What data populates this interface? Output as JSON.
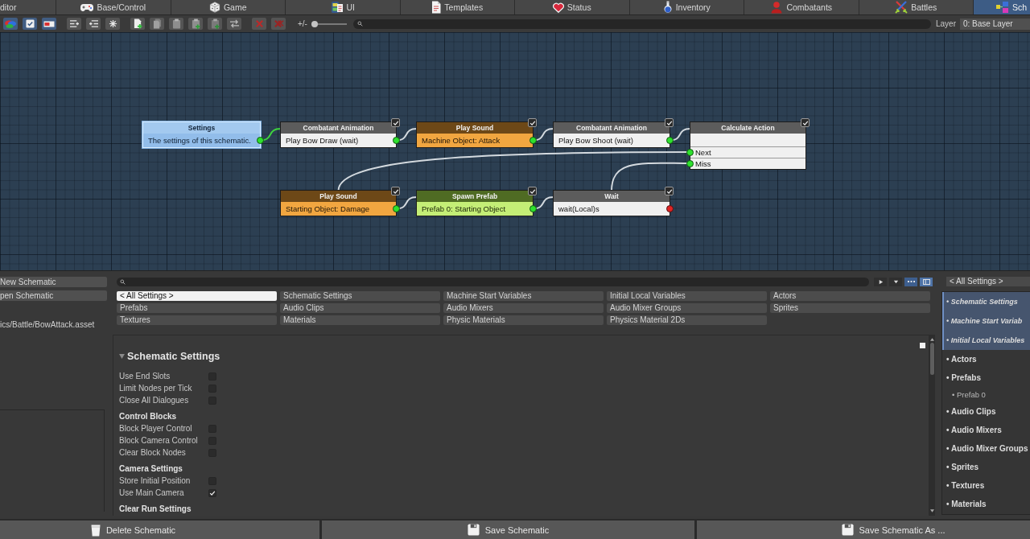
{
  "tabs": [
    {
      "label": "ditor",
      "selected": false
    },
    {
      "label": "Base/Control",
      "selected": false
    },
    {
      "label": "Game",
      "selected": false
    },
    {
      "label": "UI",
      "selected": false
    },
    {
      "label": "Templates",
      "selected": false
    },
    {
      "label": "Status",
      "selected": false
    },
    {
      "label": "Inventory",
      "selected": false
    },
    {
      "label": "Combatants",
      "selected": false
    },
    {
      "label": "Battles",
      "selected": false
    },
    {
      "label": "Sch",
      "selected": true
    }
  ],
  "toolbar": {
    "toggles": [
      {
        "on": true
      },
      {
        "on": true
      },
      {
        "on": true
      }
    ],
    "zoom_label": "+/-",
    "zoom_slider": {
      "level": 0.1
    },
    "layer_label": "Layer",
    "layer": "0: Base Layer"
  },
  "canvas": {
    "nodes": [
      {
        "title": "Settings",
        "kind": "settings",
        "selected": true,
        "rows": [
          {
            "label": "The settings of this schematic.",
            "connected": true
          }
        ]
      },
      {
        "title": "Combatant Animation",
        "kind": "step",
        "selected": false,
        "checked": true,
        "rows": [
          {
            "label": "Play Bow Draw (wait)",
            "connected": true
          }
        ]
      },
      {
        "title": "Play Sound",
        "kind": "audio",
        "selected": false,
        "checked": true,
        "rows": [
          {
            "label": "Machine Object: Attack",
            "connected": true
          }
        ]
      },
      {
        "title": "Combatant Animation",
        "kind": "step",
        "selected": false,
        "checked": true,
        "rows": [
          {
            "label": "Play Bow Shoot (wait)",
            "connected": true
          }
        ]
      },
      {
        "title": "Calculate Action",
        "kind": "check",
        "selected": false,
        "checked": true,
        "rows": [
          {
            "label": "Next",
            "connected": true
          },
          {
            "label": "Miss",
            "connected": true
          }
        ]
      },
      {
        "title": "Play Sound",
        "kind": "audio",
        "selected": false,
        "checked": true,
        "rows": [
          {
            "label": "Starting Object: Damage",
            "connected": true
          }
        ]
      },
      {
        "title": "Spawn Prefab",
        "kind": "spawn",
        "selected": false,
        "checked": true,
        "rows": [
          {
            "label": "Prefab 0: Starting Object",
            "connected": true
          }
        ]
      },
      {
        "title": "Wait",
        "kind": "step",
        "selected": false,
        "checked": true,
        "rows": [
          {
            "label": "wait(Local)s",
            "connected": false
          }
        ]
      }
    ]
  },
  "sidebar": {
    "buttons": [
      "New Schematic",
      "pen Schematic"
    ],
    "path": "ics/Battle/BowAttack.asset"
  },
  "settings_filter": [
    {
      "label": "< All Settings >",
      "selected": true
    },
    {
      "label": "Schematic Settings",
      "selected": false
    },
    {
      "label": "Machine Start Variables",
      "selected": false
    },
    {
      "label": "Initial Local Variables",
      "selected": false
    },
    {
      "label": "Actors",
      "selected": false
    },
    {
      "label": "Prefabs",
      "selected": false
    },
    {
      "label": "Audio Clips",
      "selected": false
    },
    {
      "label": "Audio Mixers",
      "selected": false
    },
    {
      "label": "Audio Mixer Groups",
      "selected": false
    },
    {
      "label": "Sprites",
      "selected": false
    },
    {
      "label": "Textures",
      "selected": false
    },
    {
      "label": "Materials",
      "selected": false
    },
    {
      "label": "Physic Materials",
      "selected": false
    },
    {
      "label": "Physics Material 2Ds",
      "selected": false
    }
  ],
  "inspector": {
    "title": "Schematic Settings",
    "expanded": true,
    "groups": [
      {
        "fields": [
          {
            "label": "Use End Slots",
            "checked": false
          },
          {
            "label": "Limit Nodes per Tick",
            "checked": false
          },
          {
            "label": "Close All Dialogues",
            "checked": false
          }
        ]
      },
      {
        "heading": "Control Blocks",
        "fields": [
          {
            "label": "Block Player Control",
            "checked": false
          },
          {
            "label": "Block Camera Control",
            "checked": false
          },
          {
            "label": "Clear Block Nodes",
            "checked": false
          }
        ]
      },
      {
        "heading": "Camera Settings",
        "fields": [
          {
            "label": "Store Initial Position",
            "checked": false
          },
          {
            "label": "Use Main Camera",
            "checked": true
          }
        ]
      },
      {
        "heading": "Clear Run Settings"
      }
    ]
  },
  "navigator": {
    "dropdown": "< All Settings >",
    "items": [
      {
        "label": "• Schematic Settings",
        "selected": true
      },
      {
        "label": "• Machine Start Variab",
        "selected": true
      },
      {
        "label": "• Initial Local Variables",
        "selected": true
      },
      {
        "label": "• Actors",
        "selected": false
      },
      {
        "label": "• Prefabs",
        "selected": false,
        "children": [
          {
            "label": "• Prefab 0",
            "selected": false
          }
        ]
      },
      {
        "label": "• Audio Clips",
        "selected": false
      },
      {
        "label": "• Audio Mixers",
        "selected": false
      },
      {
        "label": "• Audio Mixer Groups",
        "selected": false
      },
      {
        "label": "• Sprites",
        "selected": false
      },
      {
        "label": "• Textures",
        "selected": false
      },
      {
        "label": "• Materials",
        "selected": false
      }
    ]
  },
  "footer": {
    "buttons": [
      "Delete Schematic",
      "Save Schematic",
      "Save Schematic As ..."
    ]
  }
}
